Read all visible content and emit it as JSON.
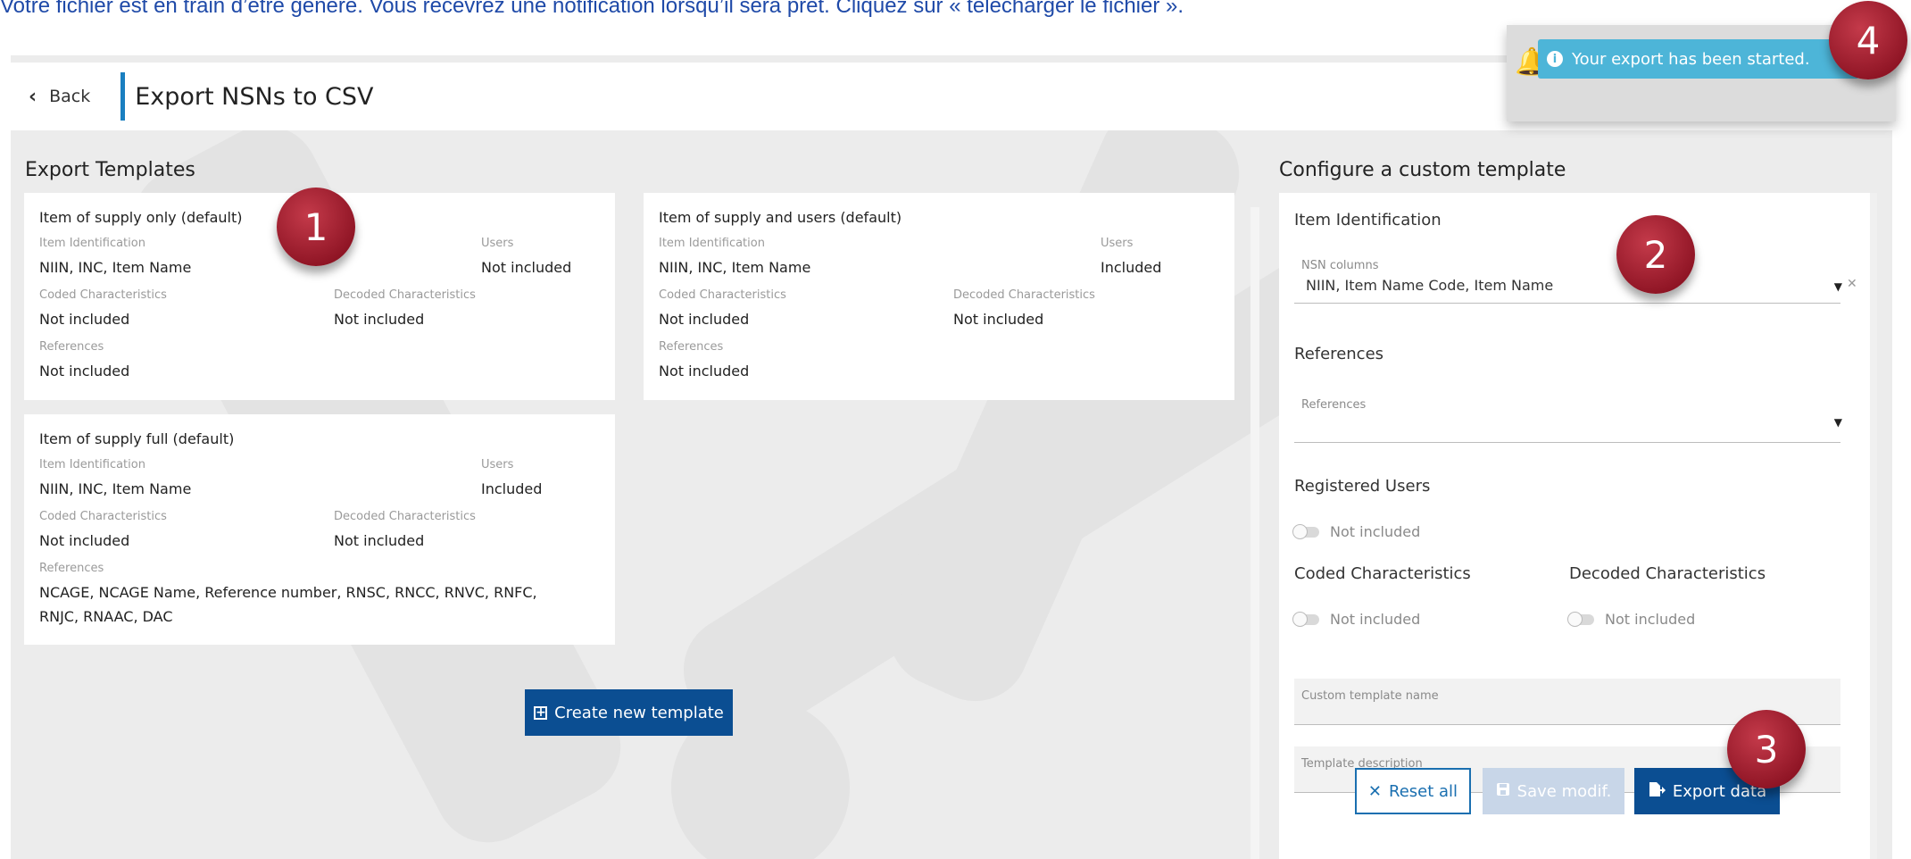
{
  "caption": "Votre fichier est en train d’être généré. Vous recevrez une notification lorsqu’il sera prêt. Cliquez sur « télécharger le fichier ».",
  "header": {
    "back_label": "Back",
    "title": "Export NSNs to CSV"
  },
  "export_templates": {
    "title": "Export Templates",
    "cards": [
      {
        "title": "Item of supply only (default)",
        "item_identification_label": "Item Identification",
        "item_identification": "NIIN, INC, Item Name",
        "users_label": "Users",
        "users": "Not included",
        "coded_label": "Coded Characteristics",
        "coded": "Not included",
        "decoded_label": "Decoded Characteristics",
        "decoded": "Not included",
        "references_label": "References",
        "references": "Not included"
      },
      {
        "title": "Item of supply and users (default)",
        "item_identification_label": "Item Identification",
        "item_identification": "NIIN, INC, Item Name",
        "users_label": "Users",
        "users": "Included",
        "coded_label": "Coded Characteristics",
        "coded": "Not included",
        "decoded_label": "Decoded Characteristics",
        "decoded": "Not included",
        "references_label": "References",
        "references": "Not included"
      },
      {
        "title": "Item of supply full (default)",
        "item_identification_label": "Item Identification",
        "item_identification": "NIIN, INC, Item Name",
        "users_label": "Users",
        "users": "Included",
        "coded_label": "Coded Characteristics",
        "coded": "Not included",
        "decoded_label": "Decoded Characteristics",
        "decoded": "Not included",
        "references_label": "References",
        "references": "NCAGE, NCAGE Name, Reference number, RNSC, RNCC, RNVC, RNFC, RNJC, RNAAC, DAC"
      }
    ],
    "create_button": "Create new template"
  },
  "custom_template": {
    "title": "Configure a custom template",
    "item_identification_heading": "Item Identification",
    "nsn_columns_label": "NSN columns",
    "nsn_columns_value": "NIIN, Item Name Code, Item Name",
    "references_heading": "References",
    "references_label": "References",
    "registered_users_heading": "Registered Users",
    "registered_users_toggle": "Not included",
    "coded_heading": "Coded Characteristics",
    "coded_toggle": "Not included",
    "decoded_heading": "Decoded Characteristics",
    "decoded_toggle": "Not included",
    "template_name_label": "Custom template name",
    "template_description_label": "Template description",
    "reset_button": "Reset all",
    "save_button": "Save modif.",
    "export_button": "Export data"
  },
  "notification": {
    "message": "Your export has been started."
  },
  "callouts": [
    "1",
    "2",
    "3",
    "4"
  ],
  "colors": {
    "primary": "#0b4e92",
    "accent_bar": "#1a7fc0",
    "toast": "#4db5d8",
    "callout": "#a01c2c"
  }
}
